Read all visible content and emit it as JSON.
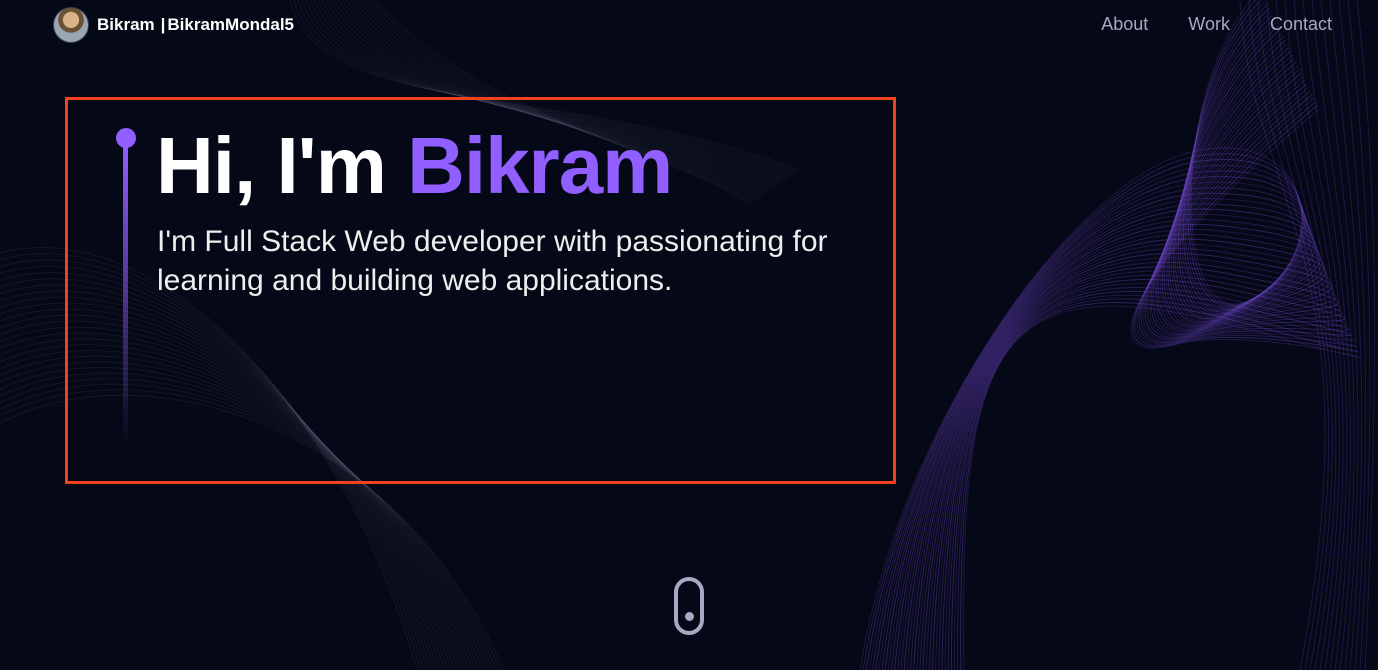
{
  "nav": {
    "brand_name": "Bikram",
    "brand_separator": "|",
    "brand_handle": "BikramMondal5",
    "links": [
      {
        "label": "About"
      },
      {
        "label": "Work"
      },
      {
        "label": "Contact"
      }
    ]
  },
  "hero": {
    "greeting": "Hi, I'm ",
    "name": "Bikram",
    "subtitle": "I'm Full Stack Web developer with passionating for learning and building web applications."
  },
  "colors": {
    "background": "#050816",
    "accent": "#915eff",
    "highlight_border": "#f1411d",
    "secondary_text": "#aaa6c3"
  },
  "icons": {
    "scroll": "scroll-mouse-icon"
  }
}
